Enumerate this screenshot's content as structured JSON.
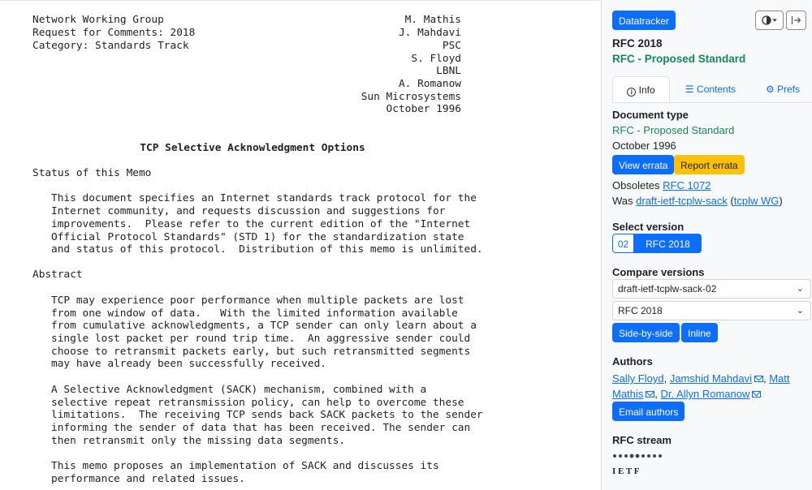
{
  "document": {
    "header_left": [
      "Network Working Group",
      "Request for Comments: 2018",
      "Category: Standards Track"
    ],
    "header_right": [
      "M. Mathis",
      "J. Mahdavi",
      "PSC",
      "S. Floyd",
      "LBNL",
      "A. Romanow",
      "Sun Microsystems",
      "October 1996"
    ],
    "title": "TCP Selective Acknowledgment Options",
    "status_heading": "Status of this Memo",
    "status_lines": [
      "This document specifies an Internet standards track protocol for the",
      "Internet community, and requests discussion and suggestions for",
      "improvements.  Please refer to the current edition of the \"Internet",
      "Official Protocol Standards\" (STD 1) for the standardization state",
      "and status of this protocol.  Distribution of this memo is unlimited."
    ],
    "abstract_heading": "Abstract",
    "abstract_p1": [
      "TCP may experience poor performance when multiple packets are lost",
      "from one window of data.   With the limited information available",
      "from cumulative acknowledgments, a TCP sender can only learn about a",
      "single lost packet per round trip time.  An aggressive sender could",
      "choose to retransmit packets early, but such retransmitted segments",
      "may have already been successfully received."
    ],
    "abstract_p2": [
      "A Selective Acknowledgment (SACK) mechanism, combined with a",
      "selective repeat retransmission policy, can help to overcome these",
      "limitations.  The receiving TCP sends back SACK packets to the sender",
      "informing the sender of data that has been received. The sender can",
      "then retransmit only the missing data segments."
    ],
    "abstract_p3": [
      "This memo proposes an implementation of SACK and discusses its",
      "performance and related issues."
    ]
  },
  "sidebar": {
    "datatracker_label": "Datatracker",
    "rfc_title": "RFC 2018",
    "rfc_status": "RFC - Proposed Standard",
    "tabs": {
      "info": "Info",
      "contents": "Contents",
      "prefs": "Prefs"
    },
    "doc_type_heading": "Document type",
    "doc_type_value": "RFC - Proposed Standard",
    "doc_date": "October 1996",
    "view_errata": "View errata",
    "report_errata": "Report errata",
    "obsoletes_prefix": "Obsoletes ",
    "obsoletes_link": "RFC 1072",
    "was_prefix": "Was ",
    "was_link": "draft-ietf-tcplw-sack",
    "wg_open": " (",
    "wg_link": "tcplw WG",
    "wg_close": ")",
    "select_version_heading": "Select version",
    "versions": [
      "02",
      "RFC 2018"
    ],
    "compare_heading": "Compare versions",
    "compare_from": "draft-ietf-tcplw-sack-02",
    "compare_to": "RFC 2018",
    "side_by_side": "Side-by-side",
    "inline": "Inline",
    "authors_heading": "Authors",
    "authors": [
      "Sally Floyd",
      "Jamshid Mahdavi",
      "Matt Mathis",
      "Dr. Allyn Romanow"
    ],
    "sep": ", ",
    "email_authors": "Email authors",
    "stream_heading": "RFC stream",
    "ietf_logo_text": "I E T F"
  },
  "colors": {
    "primary": "#0d6efd",
    "warning": "#ffc107",
    "green": "#198754"
  }
}
